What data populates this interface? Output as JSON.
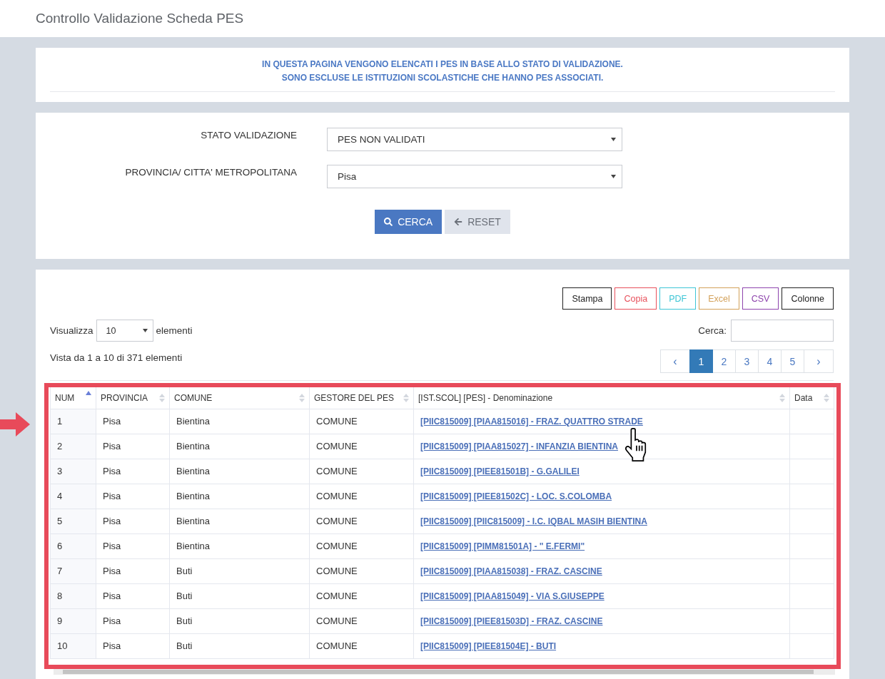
{
  "page": {
    "title": "Controllo Validazione Scheda PES"
  },
  "notice": {
    "lines": [
      "IN QUESTA PAGINA VENGONO ELENCATI I PES IN BASE ALLO STATO DI VALIDAZIONE.",
      "SONO ESCLUSE LE ISTITUZIONI SCOLASTICHE CHE HANNO PES ASSOCIATI."
    ]
  },
  "filters": {
    "fields": [
      {
        "label": "STATO VALIDAZIONE",
        "value": "PES NON VALIDATI"
      },
      {
        "label": "PROVINCIA/ CITTA' METROPOLITANA",
        "value": "Pisa"
      }
    ],
    "buttons": [
      {
        "kind": "search",
        "label": "CERCA"
      },
      {
        "kind": "reset",
        "label": "RESET"
      }
    ]
  },
  "export_buttons": [
    {
      "label": "Stampa",
      "color": "#222222"
    },
    {
      "label": "Copia",
      "color": "#e8505b"
    },
    {
      "label": "PDF",
      "color": "#3ec6d6"
    },
    {
      "label": "Excel",
      "color": "#d3a15a"
    },
    {
      "label": "CSV",
      "color": "#8e44ad"
    },
    {
      "label": "Colonne",
      "color": "#222222"
    }
  ],
  "length_menu": {
    "prefix": "Visualizza",
    "value": "10",
    "suffix": "elementi"
  },
  "search": {
    "label": "Cerca:"
  },
  "info": "Vista da 1 a 10 di 371 elementi",
  "pagination": {
    "previous": "‹",
    "pages": [
      {
        "label": "1",
        "selected": true
      },
      {
        "label": "2",
        "selected": false
      },
      {
        "label": "3",
        "selected": false
      },
      {
        "label": "4",
        "selected": false
      },
      {
        "label": "5",
        "selected": false
      }
    ],
    "next": "›"
  },
  "table": {
    "columns": [
      {
        "label": "NUM",
        "sorted": true
      },
      {
        "label": "PROVINCIA",
        "sorted": false
      },
      {
        "label": "COMUNE",
        "sorted": false
      },
      {
        "label": "GESTORE DEL PES",
        "sorted": false
      },
      {
        "label": "[IST.SCOL] [PES] - Denominazione",
        "sorted": false
      },
      {
        "label": "Data",
        "sorted": false
      }
    ],
    "rows": [
      {
        "num": "1",
        "provincia": "Pisa",
        "comune": "Bientina",
        "gestore": "COMUNE",
        "denominazione": "[PIIC815009] [PIAA815016] - FRAZ. QUATTRO STRADE"
      },
      {
        "num": "2",
        "provincia": "Pisa",
        "comune": "Bientina",
        "gestore": "COMUNE",
        "denominazione": "[PIIC815009] [PIAA815027] - INFANZIA BIENTINA"
      },
      {
        "num": "3",
        "provincia": "Pisa",
        "comune": "Bientina",
        "gestore": "COMUNE",
        "denominazione": "[PIIC815009] [PIEE81501B] - G.GALILEI"
      },
      {
        "num": "4",
        "provincia": "Pisa",
        "comune": "Bientina",
        "gestore": "COMUNE",
        "denominazione": "[PIIC815009] [PIEE81502C] - LOC. S.COLOMBA"
      },
      {
        "num": "5",
        "provincia": "Pisa",
        "comune": "Bientina",
        "gestore": "COMUNE",
        "denominazione": "[PIIC815009] [PIIC815009] - I.C. IQBAL MASIH BIENTINA"
      },
      {
        "num": "6",
        "provincia": "Pisa",
        "comune": "Bientina",
        "gestore": "COMUNE",
        "denominazione": "[PIIC815009] [PIMM81501A] - \" E.FERMI\""
      },
      {
        "num": "7",
        "provincia": "Pisa",
        "comune": "Buti",
        "gestore": "COMUNE",
        "denominazione": "[PIIC815009] [PIAA815038] - FRAZ. CASCINE"
      },
      {
        "num": "8",
        "provincia": "Pisa",
        "comune": "Buti",
        "gestore": "COMUNE",
        "denominazione": "[PIIC815009] [PIAA815049] - VIA S.GIUSEPPE"
      },
      {
        "num": "9",
        "provincia": "Pisa",
        "comune": "Buti",
        "gestore": "COMUNE",
        "denominazione": "[PIIC815009] [PIEE81503D] - FRAZ. CASCINE"
      },
      {
        "num": "10",
        "provincia": "Pisa",
        "comune": "Buti",
        "gestore": "COMUNE",
        "denominazione": "[PIIC815009] [PIEE81504E] - BUTI"
      }
    ]
  }
}
